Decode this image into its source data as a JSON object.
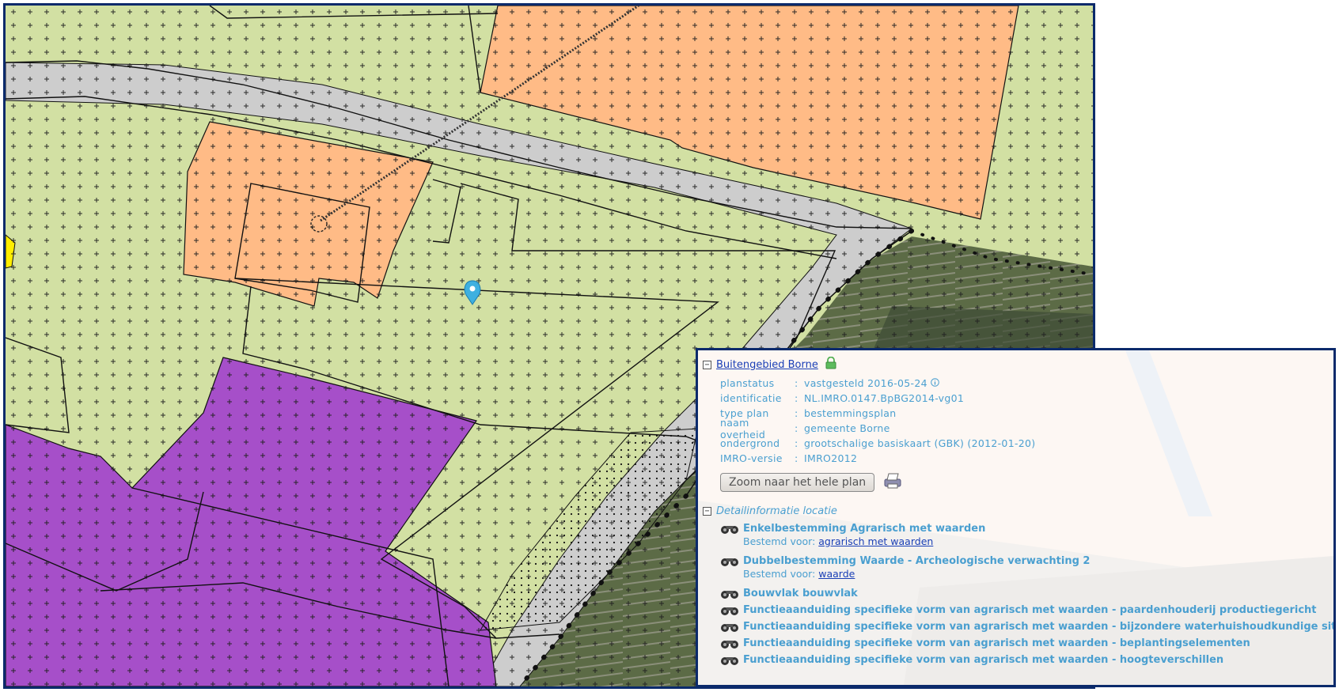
{
  "map": {
    "marker_icon": "location-pin-icon",
    "colors": {
      "agrarisch": "#d2e0a3",
      "wonen": "#ffbb86",
      "verkeer": "#cdcdcd",
      "bedrijf": "#a64fc9",
      "natuur": "#d2e0a3",
      "accent_yellow": "#ffee00"
    }
  },
  "plan": {
    "title": "Buitengebied Borne",
    "lock_icon": "lock-icon",
    "properties": [
      {
        "key": "planstatus",
        "value": "vastgesteld 2016-05-24"
      },
      {
        "key": "identificatie",
        "value": "NL.IMRO.0147.BpBG2014-vg01"
      },
      {
        "key": "type plan",
        "value": "bestemmingsplan"
      },
      {
        "key": "naam overheid",
        "value": "gemeente Borne"
      },
      {
        "key": "ondergrond",
        "value": "grootschalige basiskaart (GBK) (2012-01-20)"
      },
      {
        "key": "IMRO-versie",
        "value": "IMRO2012"
      }
    ],
    "separator": ":",
    "zoom_button": "Zoom naar het hele plan",
    "print_icon": "printer-icon"
  },
  "detail": {
    "title": "Detailinformatie locatie",
    "bestemd_prefix": "Bestemd voor:",
    "items": [
      {
        "label": "Enkelbestemming Agrarisch met waarden",
        "bestemd_voor": "agrarisch met waarden"
      },
      {
        "label": "Dubbelbestemming Waarde - Archeologische verwachting 2",
        "bestemd_voor": "waarde"
      },
      {
        "label": "Bouwvlak bouwvlak"
      },
      {
        "label": "Functieaanduiding specifieke vorm van agrarisch met waarden - paardenhouderij productiegericht"
      },
      {
        "label": "Functieaanduiding specifieke vorm van agrarisch met waarden - bijzondere waterhuishoudkundige situatie"
      },
      {
        "label": "Functieaanduiding specifieke vorm van agrarisch met waarden - beplantingselementen"
      },
      {
        "label": "Functieaanduiding specifieke vorm van agrarisch met waarden - hoogteverschillen"
      }
    ]
  }
}
